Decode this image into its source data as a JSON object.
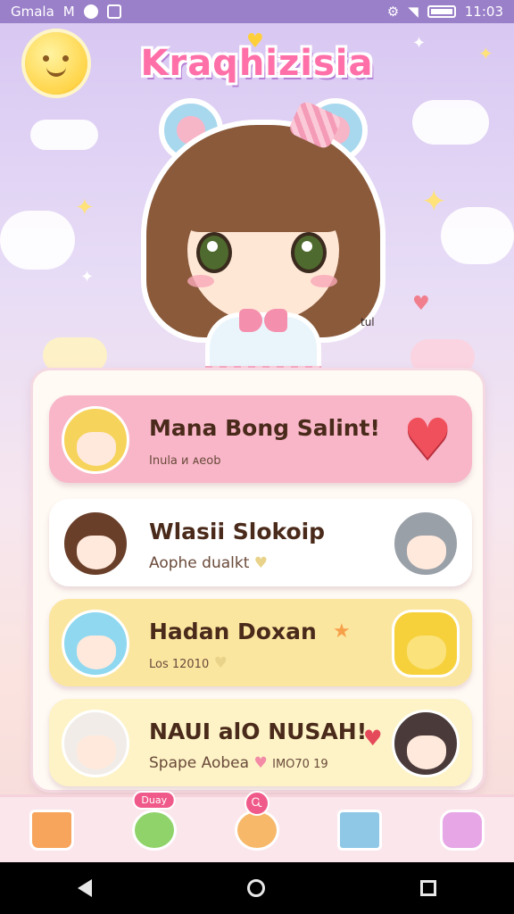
{
  "status_bar": {
    "left_text": "Gmala",
    "left_extra": "M",
    "time": "11:03"
  },
  "app": {
    "title": "Kraqhizisia",
    "signature": "tul"
  },
  "characters": [
    {
      "name": "Mana Bong Salint!",
      "subtitle": "Inula ᴎ ᴀeob",
      "icon": "heart-icon",
      "bg": "#f8b6c8"
    },
    {
      "name": "Wlasii Slokoip",
      "subtitle": "Aophe dualkt",
      "icon": "heart-icon",
      "bg": "#ffffff"
    },
    {
      "name": "Hadan Doxan",
      "subtitle": "Los 12010",
      "icon": "star-icon",
      "bg": "#fbe6a0"
    },
    {
      "name": "NAUI alO NUSAH!",
      "subtitle": "Spape Aobea",
      "subtitle_extra": "IMO70 19",
      "icon": "heart-icon",
      "bg": "#fdf3c6"
    }
  ],
  "bottom_nav": {
    "badge1": "Duay",
    "badge2": "Ꮹ",
    "items": [
      "home-icon",
      "frog-icon",
      "bear-icon",
      "book-icon",
      "bunny-cup-icon"
    ]
  },
  "colors": {
    "status_bar": "#9a7fc9",
    "title": "#ff6fa8",
    "heart": "#f0505c",
    "panel": "#fffaf4"
  }
}
